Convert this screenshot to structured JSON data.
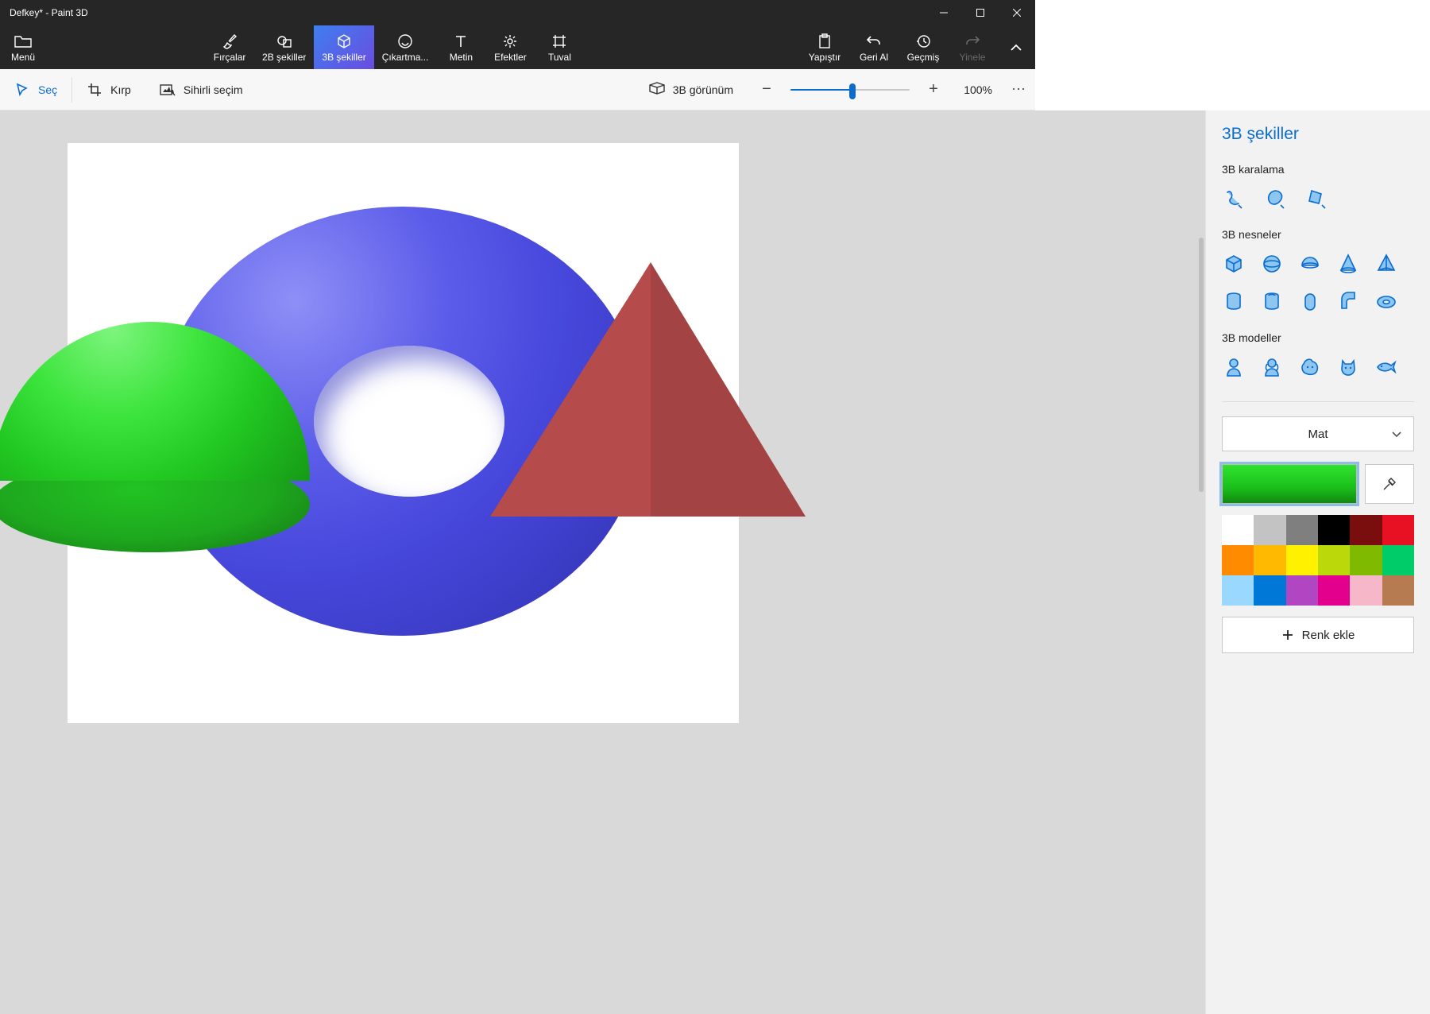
{
  "window": {
    "title": "Defkey* - Paint 3D"
  },
  "ribbon": {
    "menu": "Menü",
    "brushes": "Fırçalar",
    "shapes2d": "2B şekiller",
    "shapes3d": "3B şekiller",
    "stickers": "Çıkartma...",
    "text": "Metin",
    "effects": "Efektler",
    "canvas": "Tuval",
    "paste": "Yapıştır",
    "undo": "Geri Al",
    "history": "Geçmiş",
    "redo": "Yinele"
  },
  "subbar": {
    "select": "Seç",
    "crop": "Kırp",
    "magic": "Sihirli seçim",
    "view3d": "3B görünüm",
    "zoom_percent": "100%",
    "zoom_value": 52
  },
  "panel": {
    "title": "3B şekiller",
    "scribble": "3B karalama",
    "objects": "3B nesneler",
    "models": "3B modeller",
    "material": "Mat",
    "add_color": "Renk ekle",
    "current_color": "#1bbf1b",
    "palette": [
      "#ffffff",
      "#c3c3c3",
      "#7f7f7f",
      "#000000",
      "#7a0d0d",
      "#e81123",
      "#ff8c00",
      "#ffb900",
      "#fff100",
      "#bad80a",
      "#7fba00",
      "#00cc6a",
      "#9ad8ff",
      "#0078d7",
      "#b146c2",
      "#e3008c",
      "#f6b8c9",
      "#b77b52"
    ]
  }
}
